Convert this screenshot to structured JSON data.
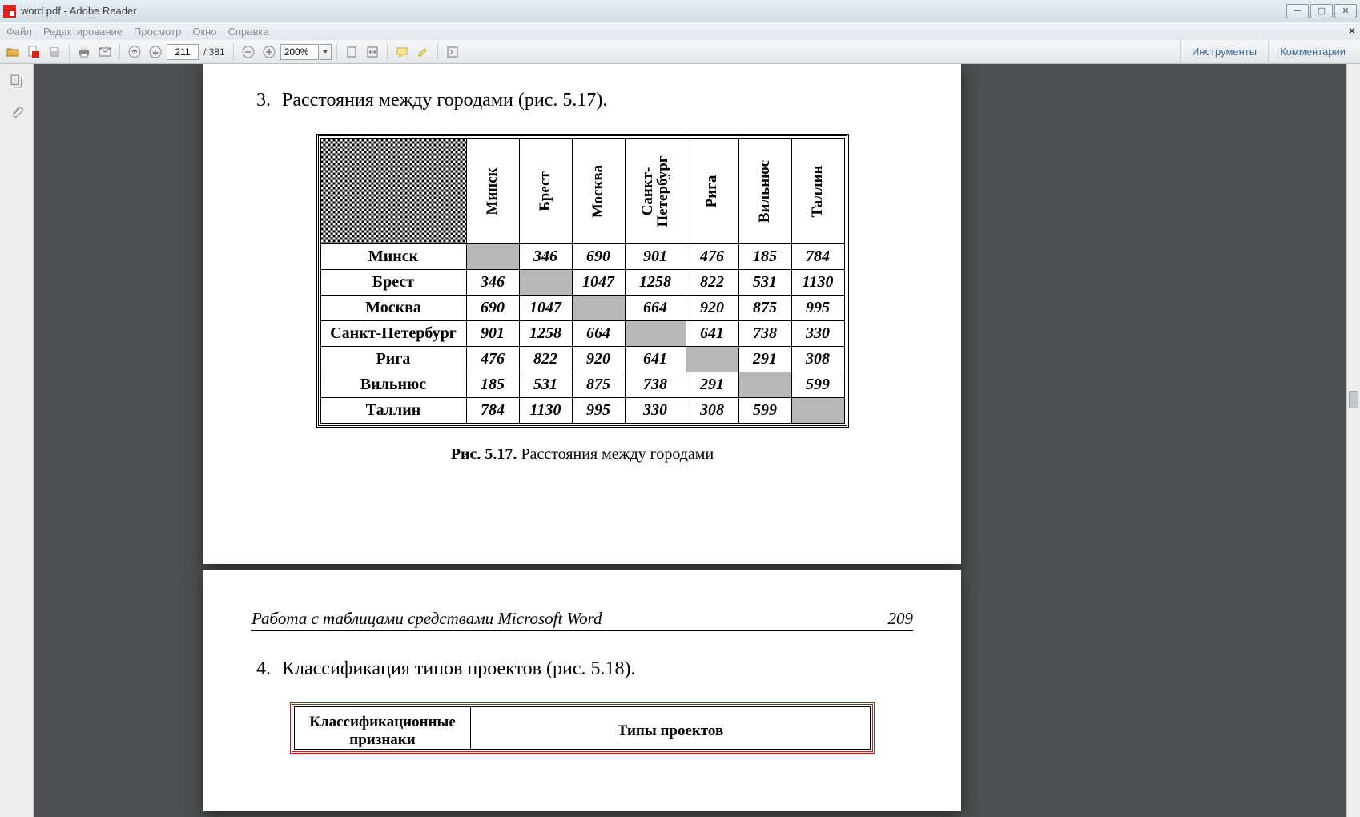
{
  "window": {
    "title": "word.pdf - Adobe Reader"
  },
  "menu": {
    "file": "Файл",
    "edit": "Редактирование",
    "view": "Просмотр",
    "window": "Окно",
    "help": "Справка"
  },
  "toolbar": {
    "page_current": "211",
    "page_total": "/ 381",
    "zoom": "200%",
    "tools": "Инструменты",
    "comments": "Комментарии"
  },
  "doc": {
    "item3_num": "3.",
    "item3_text": "Расстояния между городами (рис. 5.17).",
    "fig_caption_bold": "Рис. 5.17.",
    "fig_caption_rest": " Расстояния между городами",
    "running_title": "Работа с таблицами средствами Microsoft Word",
    "running_page": "209",
    "item4_num": "4.",
    "item4_text": "Классификация типов проектов (рис. 5.18).",
    "proj_h1": "Классификационные признаки",
    "proj_h2": "Типы проектов",
    "cities": [
      "Минск",
      "Брест",
      "Москва",
      "Санкт-Петербург",
      "Рига",
      "Вильнюс",
      "Таллин"
    ],
    "city_sp_l1": "Санкт-",
    "city_sp_l2": "Петербург",
    "dist_rows": [
      {
        "label": "Минск",
        "cells": [
          null,
          "346",
          "690",
          "901",
          "476",
          "185",
          "784"
        ]
      },
      {
        "label": "Брест",
        "cells": [
          "346",
          null,
          "1047",
          "1258",
          "822",
          "531",
          "1130"
        ]
      },
      {
        "label": "Москва",
        "cells": [
          "690",
          "1047",
          null,
          "664",
          "920",
          "875",
          "995"
        ]
      },
      {
        "label": "Санкт-Петербург",
        "cells": [
          "901",
          "1258",
          "664",
          null,
          "641",
          "738",
          "330"
        ]
      },
      {
        "label": "Рига",
        "cells": [
          "476",
          "822",
          "920",
          "641",
          null,
          "291",
          "308"
        ]
      },
      {
        "label": "Вильнюс",
        "cells": [
          "185",
          "531",
          "875",
          "738",
          "291",
          null,
          "599"
        ]
      },
      {
        "label": "Таллин",
        "cells": [
          "784",
          "1130",
          "995",
          "330",
          "308",
          "599",
          null
        ]
      }
    ]
  }
}
